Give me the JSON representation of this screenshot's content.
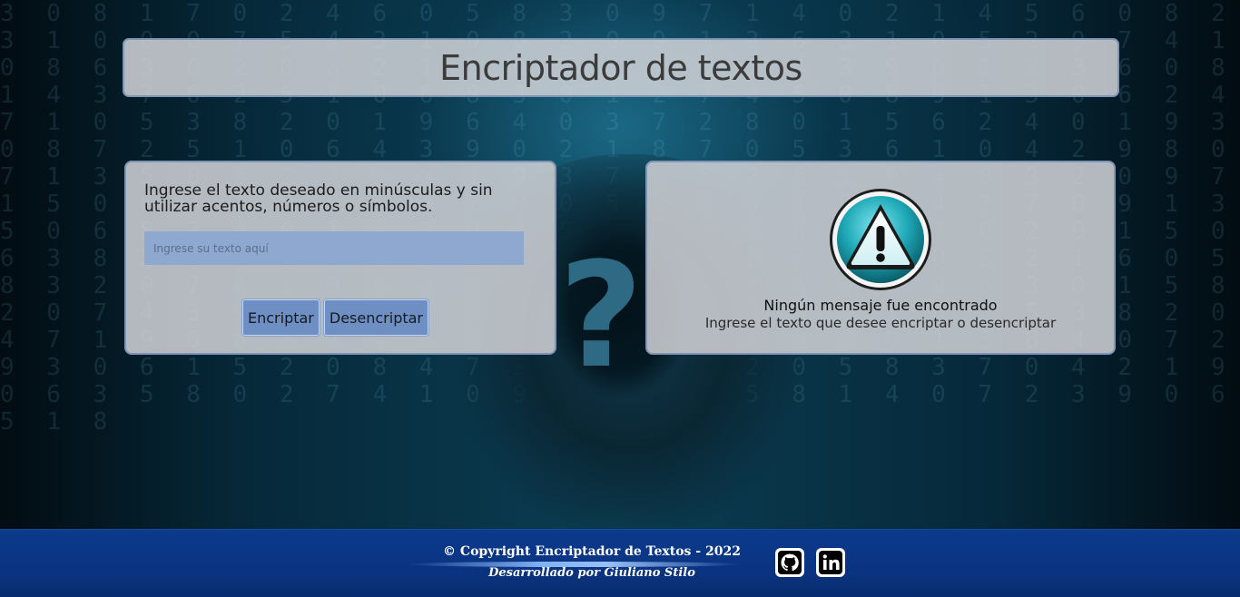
{
  "header": {
    "title": "Encriptador de textos"
  },
  "background": {
    "digits": "3 0 8 1 7 0 2 4 6 0 5 8 3 0 9 7 1 4 0 2 1 4 5 6 0 8 2 3 1 0 0 0 7 5 4 3 1 0 8 2 0 9 1 3 6 3 1 0 5 2 9 7 4 1 0 8 6 3 0 2 0 8 2 1 2 0 3 0 7 0 1 4 3 9 0 1 2 3 6 0 8 1 4 3 7 0 2 5 1 0 6 8 3 0 1 2 7 4 5 0 8 9 1 3 0 6 2 4 7 1 0 5 3 8 2 0 1 9 6 4 0 3 7 2 8 0 1 5 6 2 4 0 1 9 3 0 8 7 2 5 1 0 6 4 3 9 0 2 1 8 7 0 5 3 6 1 0 4 2 9 8 0 7 1 3 5 0 6 2 4 0 8 1 9 3 7 0 5 2 6 1 0 4 8 3 2 0 9 7 1 5 0 6 3 2 8 0 1 4 7 9 0 5 2 3 6 1 0 8 4 2 7 0 9 1 3 5 0 6 8 2 4 0 1 7 3 9 0 5 6 2 1 0 8 4 3 7 0 2 9 1 5 0 6 3 8 2 0 4 1 7 9 0 3 5 6 2 1 0 8 7 4 3 0 9 2 1 6 0 5 8 3 2 0 7 4 1 9 0 6 2 3 5 0 8 1 7 4 0 2 9 6 3 0 1 5 8 2 0 7 4 3 9 0 6 1 2 5 0 8 3 7 4 0 9 2 1 6 0 5 3 8 2 0 4 7 1 9 0 6 3 2 5 0 8 1 4 7 0 9 2 3 6 0 1 5 8 4 0 7 2 9 3 0 6 1 5 2 0 8 4 7 3 0 9 6 1 2 0 5 8 3 7 0 4 2 1 9 0 6 3 5 8 0 2 7 4 1 0 9 3 6 2 0 5 8 1 4 0 7 2 3 9 0 6 5 1 8"
  },
  "input_panel": {
    "instructions": "Ingrese el texto deseado en minúsculas y sin utilizar acentos, números o símbolos.",
    "input_placeholder": "Ingrese su texto aquí",
    "input_value": "",
    "encrypt_label": "Encriptar",
    "decrypt_label": "Desencriptar"
  },
  "output_panel": {
    "icon": "warning-icon",
    "title": "Ningún mensaje fue encontrado",
    "subtitle": "Ingrese el texto que desee encriptar o desencriptar"
  },
  "decoration": {
    "question_mark": "?"
  },
  "footer": {
    "copyright": "© Copyright Encriptador de Textos - 2022",
    "author": "Desarrollado por Giuliano Stilo",
    "social": [
      "github-icon",
      "linkedin-icon"
    ]
  },
  "colors": {
    "header_bg": "#d2d4d8",
    "panel_border": "#7f95b4",
    "input_bg": "#8ea8d0",
    "button_bg": "#6e8fc3",
    "footer_bg": "#0b3a8c",
    "warning_teal": "#1fa9b8"
  }
}
